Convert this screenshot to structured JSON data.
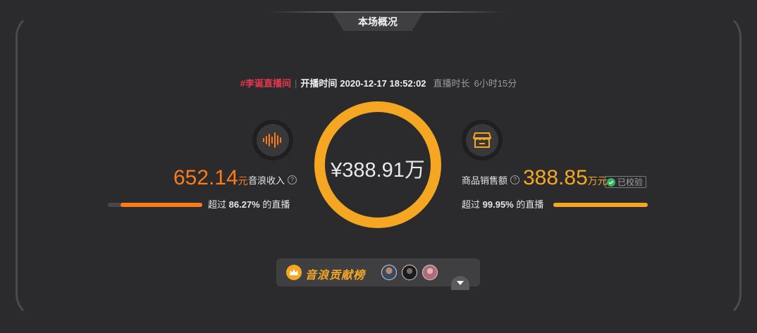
{
  "header": {
    "title": "本场概况"
  },
  "info": {
    "hashtag": "#李诞直播间",
    "start_label": "开播时间",
    "start_time": "2020-12-17 18:52:02",
    "duration_label": "直播时长",
    "duration_value": "6小时15分"
  },
  "center": {
    "total_value": "¥388.91万"
  },
  "left_stat": {
    "value": "652.14",
    "unit": "元",
    "label": "音浪收入",
    "help_icon": "question-icon",
    "icon": "sound-wave-icon",
    "pct_prefix": "超过",
    "pct_value": "86.27%",
    "pct_suffix": "的直播",
    "bar_fraction": 0.8627
  },
  "right_stat": {
    "label": "商品销售额",
    "help_icon": "question-icon",
    "icon": "store-icon",
    "value": "388.85",
    "unit": "万元",
    "verified_label": "已校验",
    "pct_prefix": "超过",
    "pct_value": "99.95%",
    "pct_suffix": "的直播",
    "bar_fraction": 0.9995
  },
  "contribution": {
    "label": "音浪贡献榜",
    "icon": "crown-icon",
    "expand_icon": "chevron-down-icon"
  },
  "colors": {
    "accent_orange": "#ff7a1a",
    "accent_gold": "#f5a623",
    "hashtag_red": "#e8364e",
    "background": "#2b2b2d"
  }
}
